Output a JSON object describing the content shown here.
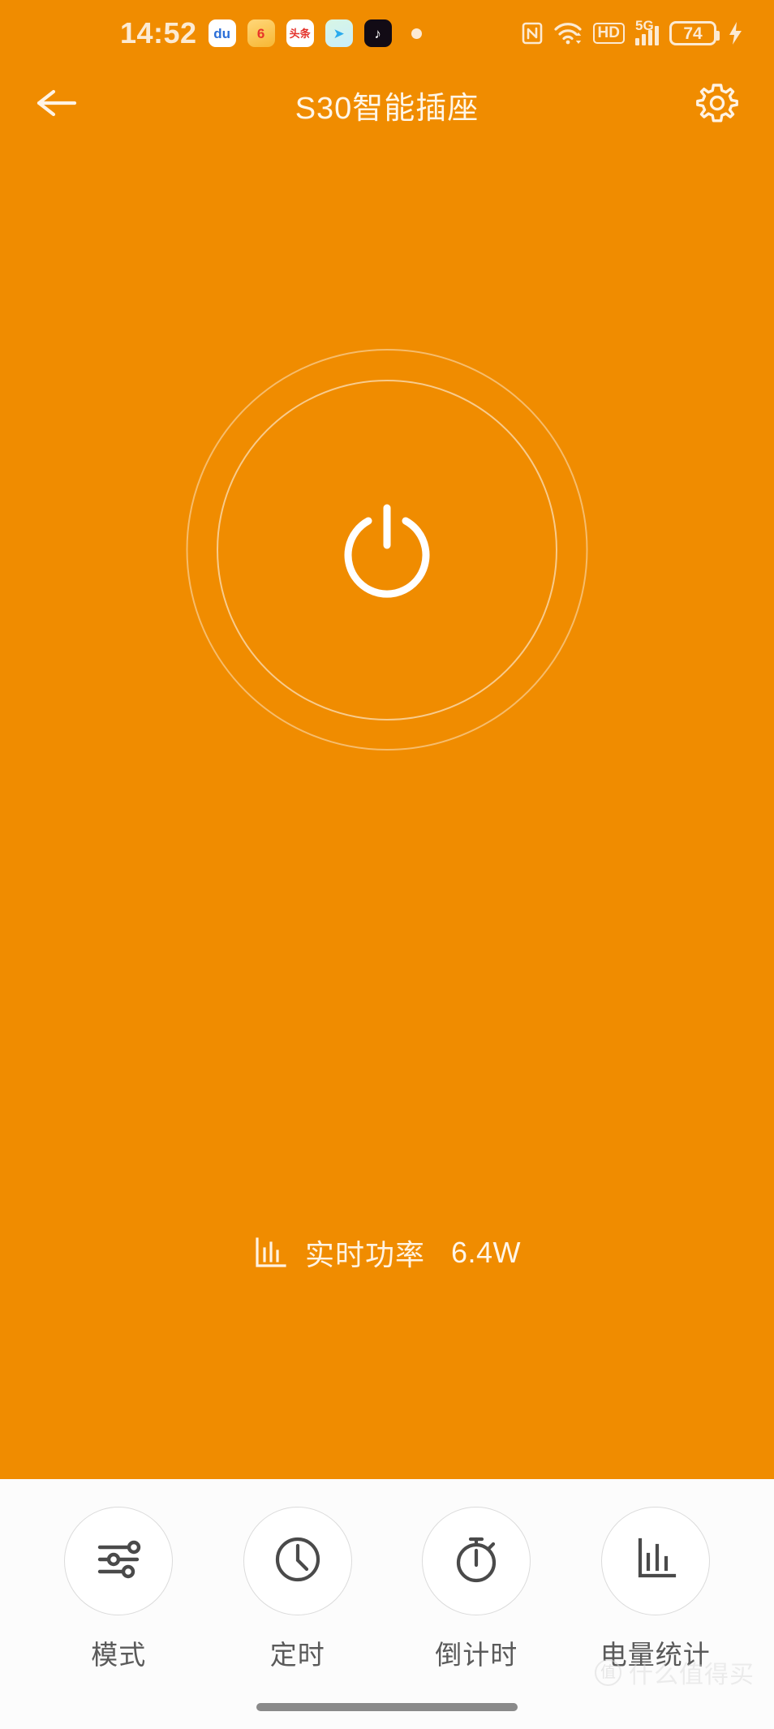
{
  "status_bar": {
    "time": "14:52",
    "app_icons": [
      {
        "name": "baidu-app-icon",
        "glyph": "du"
      },
      {
        "name": "weibo-app-icon",
        "glyph": "6"
      },
      {
        "name": "toutiao-app-icon",
        "glyph": "头条"
      },
      {
        "name": "telegram-app-icon",
        "glyph": "➤"
      },
      {
        "name": "tiktok-app-icon",
        "glyph": "♪"
      }
    ],
    "notification_dot": "•",
    "nfc_icon": "nfc-icon",
    "wifi_icon": "wifi-icon",
    "hd_label": "HD",
    "network_label": "5G",
    "signal_icon": "signal-bars-icon",
    "battery_level": "74",
    "charging_icon": "charging-bolt-icon"
  },
  "header": {
    "back_icon": "back-arrow-icon",
    "title": "S30智能插座",
    "settings_icon": "gear-icon"
  },
  "power_button": {
    "name": "power-toggle-button",
    "icon": "power-icon",
    "state": "off"
  },
  "readout": {
    "icon": "bar-chart-icon",
    "label": "实时功率",
    "value": "6.4W"
  },
  "bottom_tools": [
    {
      "name": "mode",
      "icon": "sliders-icon",
      "label": "模式"
    },
    {
      "name": "timer",
      "icon": "clock-icon",
      "label": "定时"
    },
    {
      "name": "countdown",
      "icon": "stopwatch-icon",
      "label": "倒计时"
    },
    {
      "name": "stats",
      "icon": "bar-chart-icon",
      "label": "电量统计"
    }
  ],
  "watermark": {
    "mark": "值",
    "text": "什么值得买"
  },
  "colors": {
    "background": "#F08C00",
    "panel": "#FCFCFC",
    "status_text": "#FCEAD2",
    "title": "#FFF6E8",
    "tool_label": "#5A5A5A"
  }
}
